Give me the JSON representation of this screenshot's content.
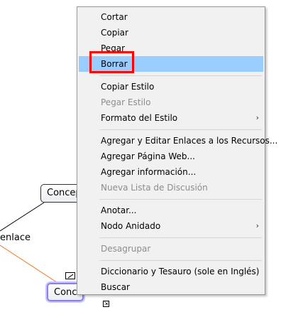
{
  "canvas": {
    "node_1_label": "Concepto",
    "node_2_label": "Concepto",
    "link_label": "enlace",
    "line_colors": {
      "primary": "#000000",
      "secondary": "#f07820"
    }
  },
  "context_menu": {
    "items": [
      {
        "label": "Cortar",
        "enabled": true
      },
      {
        "label": "Copiar",
        "enabled": true
      },
      {
        "label": "Pegar",
        "enabled": true
      },
      {
        "label": "Borrar",
        "enabled": true,
        "highlighted": true
      },
      {
        "label": "Copiar Estilo",
        "enabled": true
      },
      {
        "label": "Pegar Estilo",
        "enabled": false
      },
      {
        "label": "Formato del Estilo",
        "enabled": true,
        "submenu": true
      },
      {
        "label": "Agregar y Editar Enlaces a los Recursos...",
        "enabled": true
      },
      {
        "label": "Agregar Página Web...",
        "enabled": true
      },
      {
        "label": "Agregar información...",
        "enabled": true
      },
      {
        "label": "Nueva Lista de Discusión",
        "enabled": false
      },
      {
        "label": "Anotar...",
        "enabled": true
      },
      {
        "label": "Nodo Anidado",
        "enabled": true,
        "submenu": true
      },
      {
        "label": "Desagrupar",
        "enabled": false
      },
      {
        "label": "Diccionario y Tesauro (sole en Inglés)",
        "enabled": true
      },
      {
        "label": "Buscar",
        "enabled": true
      }
    ],
    "submenu_arrow": "›",
    "highlight_color": "#99ccff",
    "annotation_box_color": "#ff0000"
  },
  "icons": {
    "submenu": "chevron-right-icon",
    "edit": "edit-icon",
    "resize": "resize-handle-icon"
  }
}
